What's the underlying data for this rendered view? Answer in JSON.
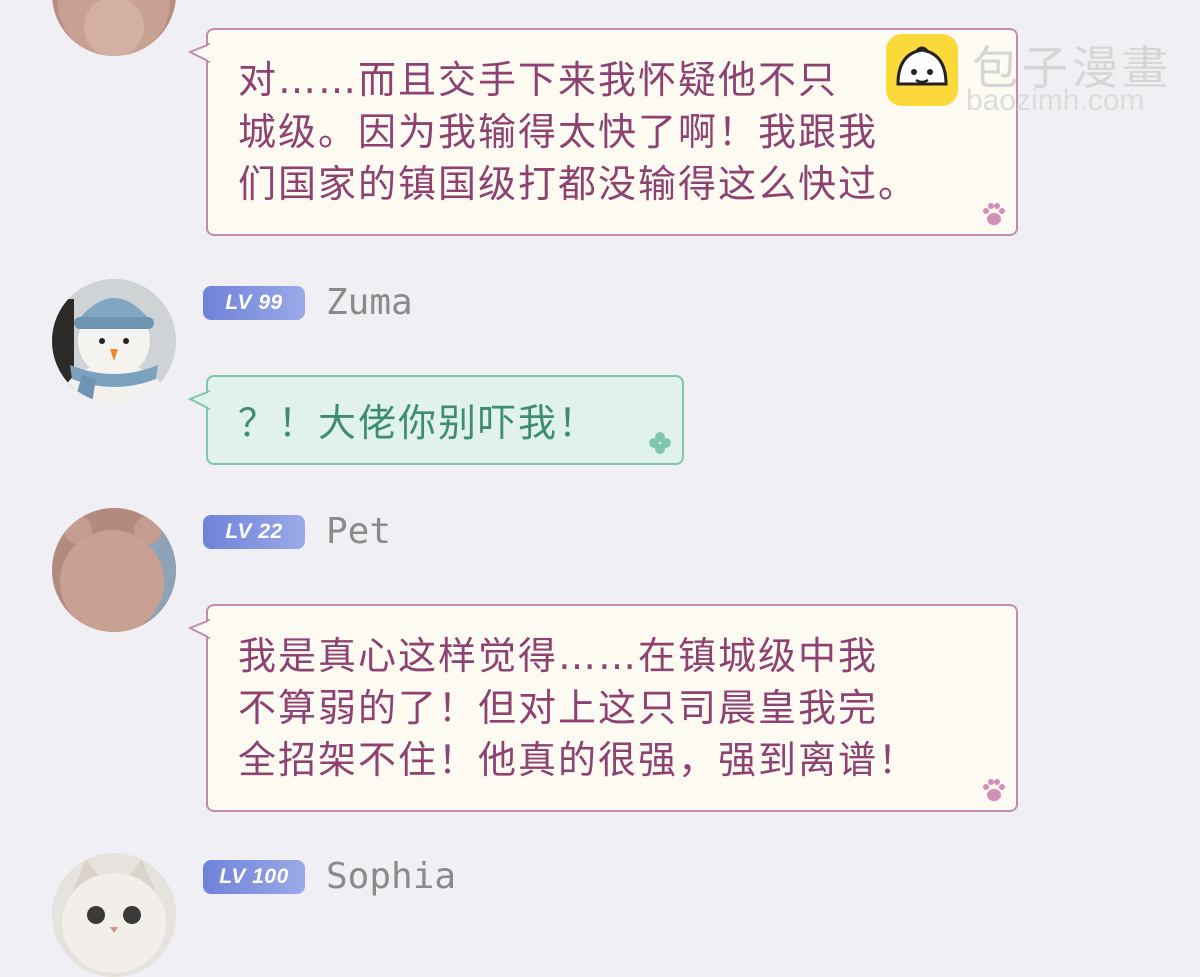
{
  "messages": [
    {
      "text": "对……而且交手下来我怀疑他不只\n城级。因为我输得太快了啊！我跟我\n们国家的镇国级打都没输得这么快过。"
    },
    {
      "level": "LV 99",
      "username": "Zuma",
      "text": "？！大佬你别吓我！"
    },
    {
      "level": "LV 22",
      "username": "Pet",
      "text": "我是真心这样觉得……在镇城级中我\n不算弱的了！但对上这只司晨皇我完\n全招架不住！他真的很强，强到离谱！"
    },
    {
      "level": "LV 100",
      "username": "Sophia"
    }
  ],
  "watermark": {
    "title": "包子漫畫",
    "url": "baozimh.com"
  },
  "colors": {
    "background": "#efeff4",
    "pink_bubble_border": "#c48bb0",
    "pink_text": "#8e4272",
    "green_bubble_bg": "#e1f2ea",
    "green_text": "#3e8c72",
    "level_badge": "#7b8bdc",
    "username": "#8a8a8a"
  },
  "icons": {
    "pink_bubble_corner": "paw-icon",
    "green_bubble_corner": "clover-icon"
  }
}
